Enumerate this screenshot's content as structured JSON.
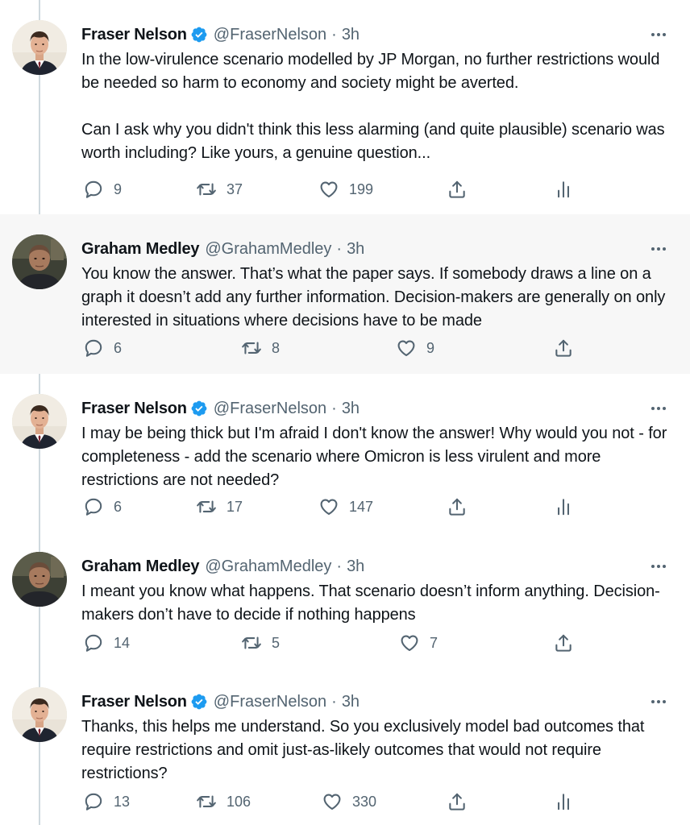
{
  "tweets": [
    {
      "name": "Fraser Nelson",
      "verified": true,
      "handle": "@FraserNelson",
      "dot": "·",
      "time": "3h",
      "paragraphs": [
        "In the low-virulence scenario modelled by JP Morgan, no further restrictions would be needed so harm to economy and society might be averted.",
        "Can I ask why you didn't think this less alarming (and quite plausible) scenario was worth including? Like yours, a genuine question..."
      ],
      "replies": "9",
      "retweets": "37",
      "likes": "199",
      "has_analytics": true
    },
    {
      "name": "Graham Medley",
      "verified": false,
      "handle": "@GrahamMedley",
      "dot": "·",
      "time": "3h",
      "paragraphs": [
        "You know the answer. That’s what the paper says. If somebody draws a line on a graph it doesn’t add any further information. Decision-makers are generally on only interested in situations where decisions have to be made"
      ],
      "replies": "6",
      "retweets": "8",
      "likes": "9",
      "has_analytics": false
    },
    {
      "name": "Fraser Nelson",
      "verified": true,
      "handle": "@FraserNelson",
      "dot": "·",
      "time": "3h",
      "paragraphs": [
        "I may be being thick but I'm afraid I don't know the answer! Why would you not - for completeness - add the scenario where Omicron is less virulent and more restrictions are not needed?"
      ],
      "replies": "6",
      "retweets": "17",
      "likes": "147",
      "has_analytics": true
    },
    {
      "name": "Graham Medley",
      "verified": false,
      "handle": "@GrahamMedley",
      "dot": "·",
      "time": "3h",
      "paragraphs": [
        "I meant you know what happens. That scenario doesn’t inform anything. Decision-makers don’t have to decide if nothing happens"
      ],
      "replies": "14",
      "retweets": "5",
      "likes": "7",
      "has_analytics": false
    },
    {
      "name": "Fraser Nelson",
      "verified": true,
      "handle": "@FraserNelson",
      "dot": "·",
      "time": "3h",
      "paragraphs": [
        "Thanks, this helps me understand. So you exclusively model bad outcomes that require restrictions and omit just-as-likely outcomes that would not require restrictions?"
      ],
      "replies": "13",
      "retweets": "106",
      "likes": "330",
      "has_analytics": true
    }
  ],
  "icons": {
    "reply": "reply-icon",
    "retweet": "retweet-icon",
    "like": "heart-icon",
    "share": "share-icon",
    "analytics": "analytics-icon",
    "more": "more-icon",
    "verified": "verified-badge-icon"
  },
  "colors": {
    "text": "#0f1419",
    "secondary": "#536471",
    "verified": "#1d9bf0",
    "highlight_bg": "#f7f7f7",
    "thread_line": "#cfd9de"
  }
}
